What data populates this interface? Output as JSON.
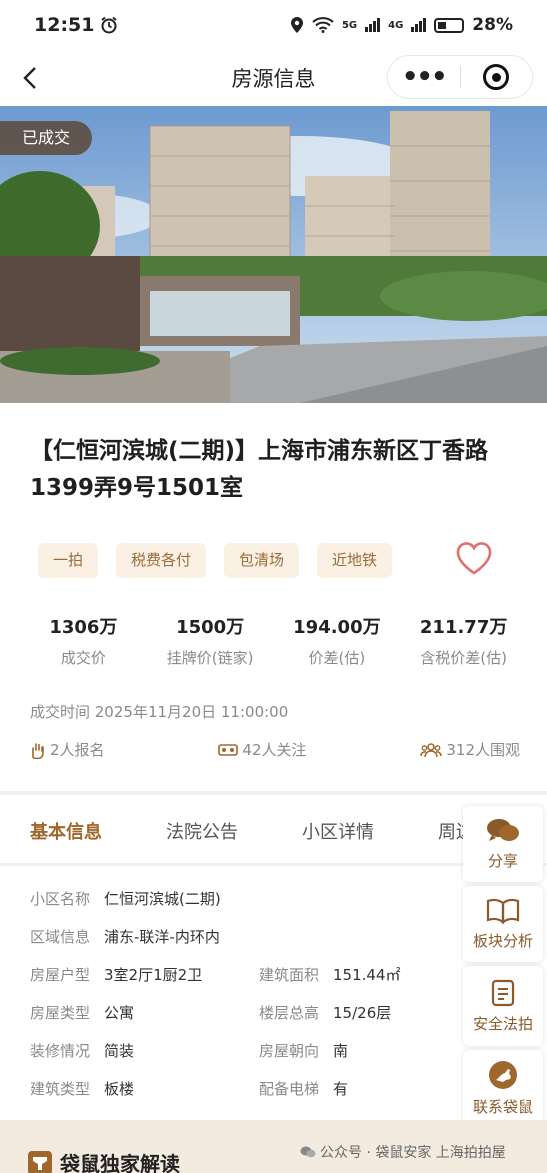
{
  "status_bar": {
    "time": "12:51",
    "signal_5g": "5G",
    "signal_4g": "4G",
    "battery": "28%"
  },
  "nav": {
    "title": "房源信息"
  },
  "hero": {
    "badge": "已成交"
  },
  "listing": {
    "title": "【仁恒河滨城(二期)】上海市浦东新区丁香路1399弄9号1501室",
    "tags": [
      "一拍",
      "税费各付",
      "包清场",
      "近地铁"
    ],
    "stats": [
      {
        "value": "1306万",
        "label": "成交价"
      },
      {
        "value": "1500万",
        "label": "挂牌价(链家)"
      },
      {
        "value": "194.00万",
        "label": "价差(估)"
      },
      {
        "value": "211.77万",
        "label": "含税价差(估)"
      }
    ],
    "deal_time": "成交时间 2025年11月20日 11:00:00",
    "registrations": "2人报名",
    "followers": "42人关注",
    "viewers": "312人围观"
  },
  "tabs": [
    "基本信息",
    "法院公告",
    "小区详情",
    "周边"
  ],
  "basic_info": {
    "community_name": {
      "label": "小区名称",
      "value": "仁恒河滨城(二期)"
    },
    "district": {
      "label": "区域信息",
      "value": "浦东-联洋-内环内"
    },
    "layout": {
      "label": "房屋户型",
      "value": "3室2厅1厨2卫"
    },
    "area": {
      "label": "建筑面积",
      "value": "151.44㎡"
    },
    "house_type": {
      "label": "房屋类型",
      "value": "公寓"
    },
    "floor": {
      "label": "楼层总高",
      "value": "15/26层"
    },
    "decoration": {
      "label": "装修情况",
      "value": "简装"
    },
    "orientation": {
      "label": "房屋朝向",
      "value": "南"
    },
    "building_type": {
      "label": "建筑类型",
      "value": "板楼"
    },
    "elevator": {
      "label": "配备电梯",
      "value": "有"
    }
  },
  "side_actions": [
    {
      "label": "分享",
      "icon": "chat-bubbles-icon"
    },
    {
      "label": "板块分析",
      "icon": "book-icon"
    },
    {
      "label": "安全法拍",
      "icon": "document-icon"
    },
    {
      "label": "联系袋鼠",
      "icon": "kangaroo-icon"
    }
  ],
  "footer": {
    "exclusive_title": "袋鼠独家解读",
    "watermark": "公众号 · 袋鼠安家 上海拍拍屋"
  },
  "colors": {
    "accent": "#a0672c",
    "tag_bg": "#faf0e4",
    "heart": "#e0706e"
  }
}
